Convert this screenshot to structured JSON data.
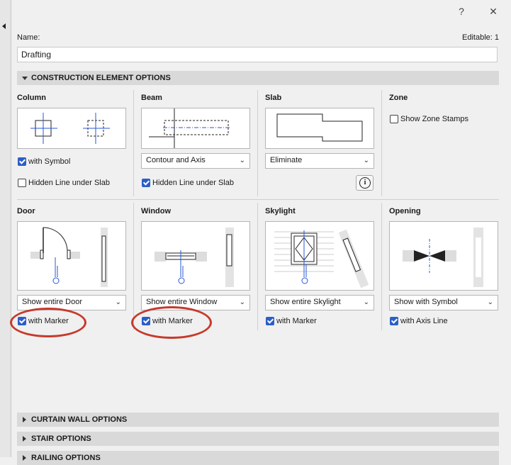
{
  "window": {
    "help_glyph": "?",
    "close_glyph": "✕"
  },
  "header": {
    "name_label": "Name:",
    "editable_label": "Editable: 1",
    "name_value": "Drafting"
  },
  "sections": {
    "construction": "CONSTRUCTION ELEMENT OPTIONS",
    "curtain_wall": "CURTAIN WALL OPTIONS",
    "stair": "STAIR OPTIONS",
    "railing": "RAILING OPTIONS"
  },
  "column": {
    "title": "Column",
    "with_symbol": "with Symbol",
    "with_symbol_checked": true,
    "hidden_line": "Hidden Line under Slab",
    "hidden_line_checked": false
  },
  "beam": {
    "title": "Beam",
    "select_value": "Contour and Axis",
    "hidden_line": "Hidden Line under Slab",
    "hidden_line_checked": true
  },
  "slab": {
    "title": "Slab",
    "select_value": "Eliminate",
    "info_glyph": "i"
  },
  "zone": {
    "title": "Zone",
    "show_stamps": "Show Zone Stamps",
    "show_stamps_checked": false
  },
  "door": {
    "title": "Door",
    "select_value": "Show entire Door",
    "marker": "with Marker",
    "marker_checked": true
  },
  "window_opt": {
    "title": "Window",
    "select_value": "Show entire Window",
    "marker": "with Marker",
    "marker_checked": true
  },
  "skylight": {
    "title": "Skylight",
    "select_value": "Show entire Skylight",
    "marker": "with Marker",
    "marker_checked": true
  },
  "opening": {
    "title": "Opening",
    "select_value": "Show with Symbol",
    "axis": "with Axis Line",
    "axis_checked": true
  },
  "colors": {
    "accent": "#2c5ec9",
    "annotation": "#c63a2c",
    "axis_line": "#2a57d6"
  }
}
